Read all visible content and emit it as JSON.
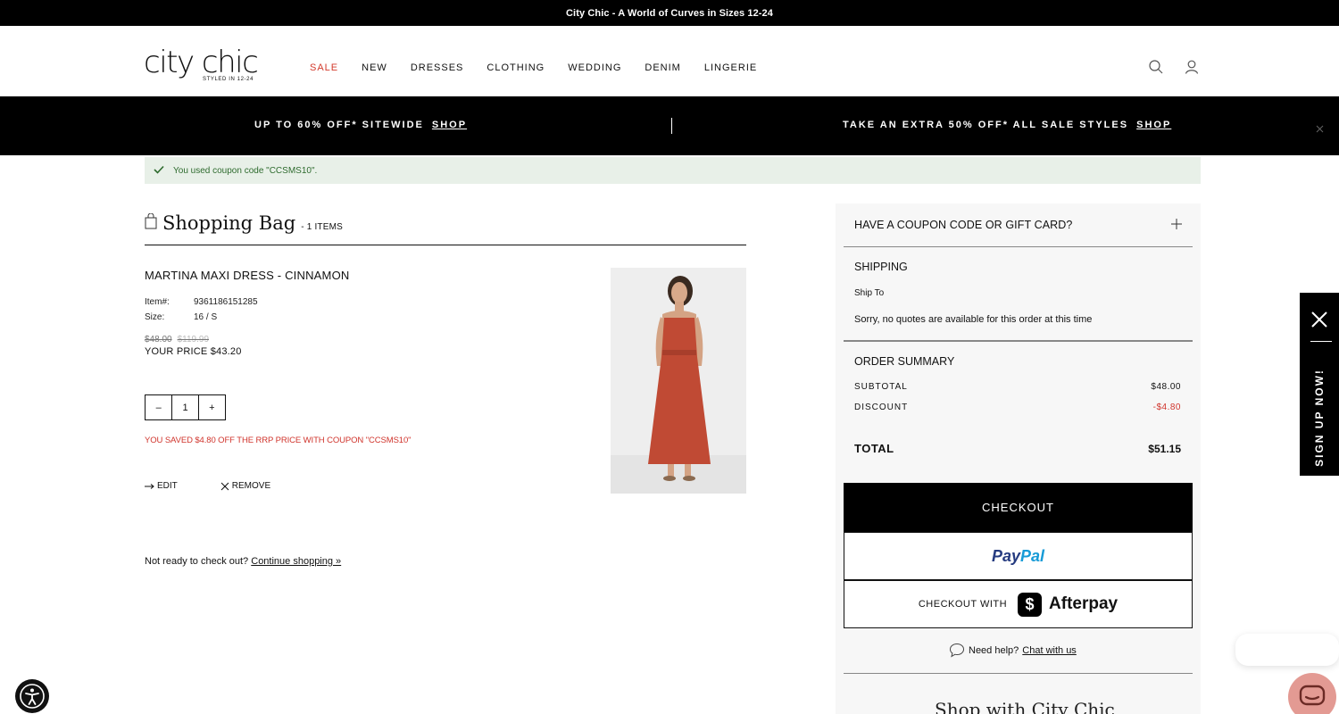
{
  "topbar": {
    "text": "City Chic - A World of Curves in Sizes 12-24"
  },
  "brand": {
    "logo_word": "city chic",
    "logo_tag": "STYLED IN 12-24",
    "sale_color": "#d33a2c"
  },
  "nav": {
    "items": [
      "SALE",
      "NEW",
      "DRESSES",
      "CLOTHING",
      "WEDDING",
      "DENIM",
      "LINGERIE"
    ]
  },
  "header_icons": [
    "search-icon",
    "account-icon"
  ],
  "promo": {
    "left_text": "UP TO 60% OFF* SITEWIDE",
    "left_link": "SHOP",
    "right_text": "TAKE AN EXTRA 50% OFF* ALL SALE STYLES",
    "right_link": "SHOP"
  },
  "coupon_message": "You used coupon code \"CCSMS10\".",
  "bag": {
    "title": "Shopping Bag",
    "count": "- 1 ITEMS",
    "product": {
      "name": "MARTINA MAXI DRESS - CINNAMON",
      "item_label": "Item#:",
      "item_value": "9361186151285",
      "size_label": "Size:",
      "size_value": "16 / S",
      "price_old": "$48.00",
      "price_rrp": "$119.99",
      "your_price": "YOUR PRICE $43.20",
      "qty_minus": "–",
      "qty_value": "1",
      "qty_plus": "+",
      "saved_text": "YOU SAVED $4.80 OFF THE RRP PRICE WITH COUPON \"CCSMS10\"",
      "edit_label": "EDIT",
      "remove_label": "REMOVE"
    },
    "not_ready_text": "Not ready to check out?",
    "continue_link": "Continue shopping »"
  },
  "summary": {
    "coupon_toggle": "HAVE A COUPON CODE OR GIFT CARD?",
    "shipping_heading": "SHIPPING",
    "ship_to": "Ship To",
    "ship_message": "Sorry, no quotes are available for this order at this time",
    "order_summary_heading": "ORDER SUMMARY",
    "subtotal_label": "SUBTOTAL",
    "subtotal_value": "$48.00",
    "discount_label": "DISCOUNT",
    "discount_value": "-$4.80",
    "total_label": "TOTAL",
    "total_value": "$51.15",
    "checkout_label": "CHECKOUT",
    "paypal_pay": "Pay",
    "paypal_pal": "Pal",
    "afterpay_prefix": "CHECKOUT WITH",
    "afterpay_logo": "Afterpay",
    "help_text": "Need help?",
    "help_link": "Chat with us",
    "shop_with": "Shop with City Chic"
  },
  "signup": {
    "label": "SIGN UP NOW!"
  },
  "colors": {
    "accent_red": "#d0342c",
    "success_bg": "#e8f0e8",
    "paypal_dark": "#253b80",
    "paypal_light": "#179bd7"
  }
}
